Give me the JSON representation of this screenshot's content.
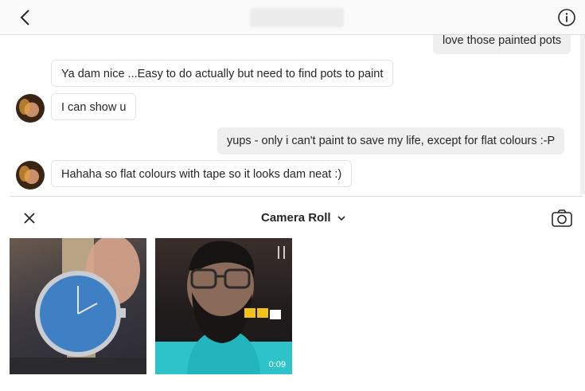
{
  "header": {
    "back_icon": "chevron-left-icon",
    "info_icon": "info-icon"
  },
  "thread": {
    "messages": [
      {
        "side": "out",
        "text": "love those painted pots"
      },
      {
        "side": "in",
        "text": "Ya dam nice ...Easy to do actually but need to find pots to paint"
      },
      {
        "side": "in",
        "text": "I can show u"
      },
      {
        "side": "out",
        "text": "yups - only i can't paint to save my life, except for flat colours :-P"
      },
      {
        "side": "in",
        "text": "Hahaha so flat colours with tape so it looks dam neat :)"
      }
    ]
  },
  "picker": {
    "title": "Camera Roll",
    "close_icon": "close-icon",
    "camera_icon": "camera-icon",
    "items": [
      {
        "kind": "photo"
      },
      {
        "kind": "video",
        "duration": "0:09"
      }
    ]
  }
}
